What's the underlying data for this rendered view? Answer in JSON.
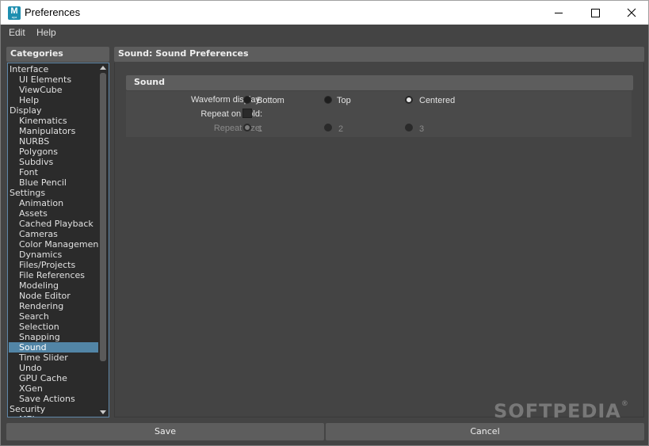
{
  "window": {
    "title": "Preferences",
    "icon": "maya-app-icon",
    "icon_letter": "M",
    "icon_sub": "aya",
    "minimize_icon": "minimize-icon",
    "maximize_icon": "maximize-icon",
    "close_icon": "close-icon"
  },
  "menubar": {
    "items": [
      "Edit",
      "Help"
    ]
  },
  "categories": {
    "header": "Categories",
    "items": [
      {
        "label": "Interface",
        "level": 0
      },
      {
        "label": "UI Elements",
        "level": 1
      },
      {
        "label": "ViewCube",
        "level": 1
      },
      {
        "label": "Help",
        "level": 1
      },
      {
        "label": "Display",
        "level": 0
      },
      {
        "label": "Kinematics",
        "level": 1
      },
      {
        "label": "Manipulators",
        "level": 1
      },
      {
        "label": "NURBS",
        "level": 1
      },
      {
        "label": "Polygons",
        "level": 1
      },
      {
        "label": "Subdivs",
        "level": 1
      },
      {
        "label": "Font",
        "level": 1
      },
      {
        "label": "Blue Pencil",
        "level": 1
      },
      {
        "label": "Settings",
        "level": 0
      },
      {
        "label": "Animation",
        "level": 1
      },
      {
        "label": "Assets",
        "level": 1
      },
      {
        "label": "Cached Playback",
        "level": 1
      },
      {
        "label": "Cameras",
        "level": 1
      },
      {
        "label": "Color Management",
        "level": 1
      },
      {
        "label": "Dynamics",
        "level": 1
      },
      {
        "label": "Files/Projects",
        "level": 1
      },
      {
        "label": "File References",
        "level": 1
      },
      {
        "label": "Modeling",
        "level": 1
      },
      {
        "label": "Node Editor",
        "level": 1
      },
      {
        "label": "Rendering",
        "level": 1
      },
      {
        "label": "Search",
        "level": 1
      },
      {
        "label": "Selection",
        "level": 1
      },
      {
        "label": "Snapping",
        "level": 1
      },
      {
        "label": "Sound",
        "level": 1,
        "selected": true
      },
      {
        "label": "Time Slider",
        "level": 1
      },
      {
        "label": "Undo",
        "level": 1
      },
      {
        "label": "GPU Cache",
        "level": 1
      },
      {
        "label": "XGen",
        "level": 1
      },
      {
        "label": "Save Actions",
        "level": 1
      },
      {
        "label": "Security",
        "level": 0
      },
      {
        "label": "MEL",
        "level": 1
      }
    ],
    "scroll_up_icon": "scroll-up-arrow-icon",
    "scroll_down_icon": "scroll-down-arrow-icon"
  },
  "main": {
    "header": "Sound: Sound Preferences",
    "section_title": "Sound",
    "waveform": {
      "label": "Waveform display:",
      "options": [
        "Bottom",
        "Top",
        "Centered"
      ],
      "selected": "Centered"
    },
    "repeat_on_hold": {
      "label": "Repeat on hold:",
      "checked": false
    },
    "repeat_size": {
      "label": "Repeat size:",
      "options": [
        "1",
        "2",
        "3"
      ],
      "selected": "1",
      "disabled": true
    }
  },
  "footer": {
    "save_label": "Save",
    "cancel_label": "Cancel"
  },
  "watermark": {
    "text": "SOFTPEDIA",
    "mark": "®"
  },
  "colors": {
    "background": "#444444",
    "panel": "#5d5d5d",
    "list_bg": "#2b2b2b",
    "selection": "#5285a6",
    "text": "#dcdcdc"
  }
}
